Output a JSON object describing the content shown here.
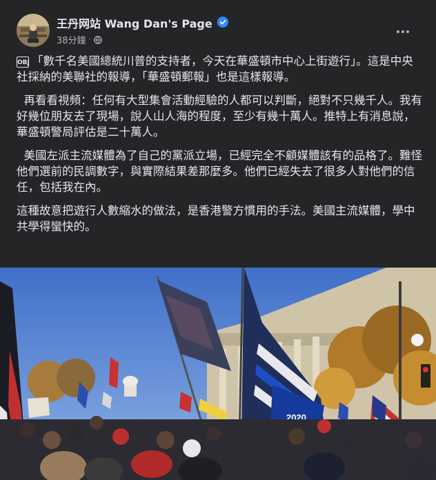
{
  "post": {
    "page_name": "王丹网站 Wang Dan's Page",
    "verified_icon": "verified-badge-icon",
    "timestamp": "38分鐘",
    "separator": "·",
    "privacy_icon": "globe-icon",
    "more_icon": "more-options-icon",
    "obj_icon_text": "OBJ",
    "paragraphs": [
      "「數千名美國總統川普的支持者，今天在華盛頓市中心上街遊行」。這是中央社採納的美聯社的報導，「華盛頓郵報」也是這樣報導。",
      "再看看視頻：任何有大型集會活動經驗的人都可以判斷，絕對不只幾千人。我有好幾位朋友去了現場，說人山人海的程度，至少有幾十萬人。推特上有消息說，華盛頓警局評估是二十萬人。",
      "美國左派主流媒體為了自己的黨派立場，已經完全不顧媒體該有的品格了。難怪他們選前的民調數字，與實際結果差那麼多。他們已經失去了很多人對他們的信任，包括我在內。",
      "這種故意把遊行人數縮水的做法，是香港警方慣用的手法。美國主流媒體，學中共學得蠻快的。"
    ],
    "photo_flag_text": "2020"
  },
  "colors": {
    "background": "#242526",
    "text_primary": "#e4e6eb",
    "text_secondary": "#b0b3b8",
    "verified_blue": "#2d88ff"
  }
}
